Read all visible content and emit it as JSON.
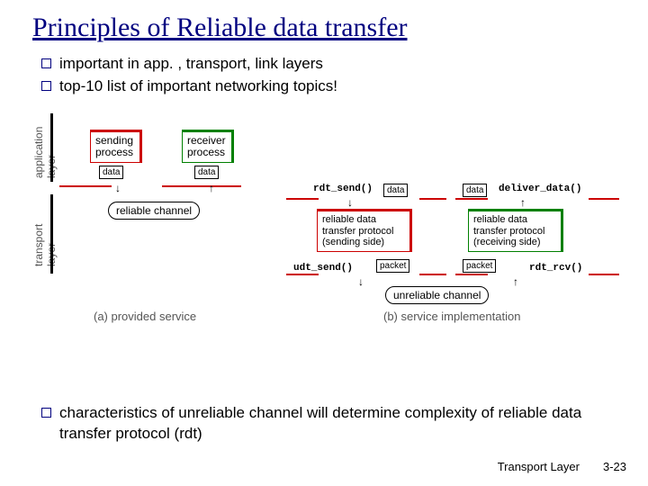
{
  "title": "Principles of Reliable data transfer",
  "bullets_top": [
    "important in app. , transport, link layers",
    "top-10 list of important networking topics!"
  ],
  "layers": {
    "application": "application\nlayer",
    "transport": "transport\nlayer"
  },
  "diagram_a": {
    "sending": "sending\nprocess",
    "receiver": "receiver\nprocess",
    "data": "data",
    "channel": "reliable channel",
    "caption": "(a)   provided service"
  },
  "diagram_b": {
    "rdt_send": "rdt_send()",
    "deliver_data": "deliver_data()",
    "data": "data",
    "send_box": "reliable data\ntransfer protocol\n(sending side)",
    "recv_box": "reliable data\ntransfer protocol\n(receiving side)",
    "udt_send": "udt_send()",
    "rdt_rcv": "rdt_rcv()",
    "packet": "packet",
    "channel": "unreliable channel",
    "caption": "(b)  service implementation"
  },
  "bullets_bottom": [
    "characteristics of unreliable channel will determine complexity of reliable data transfer protocol (rdt)"
  ],
  "footer": {
    "label": "Transport Layer",
    "page": "3-23"
  }
}
